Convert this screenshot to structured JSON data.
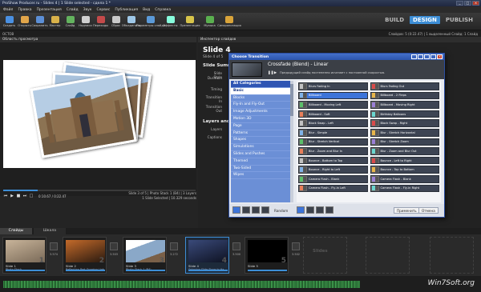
{
  "window": {
    "title": "ProShow Producer.ru - Slides 4 | 1 Slide selected - сдела 1 *",
    "buttons": [
      "_",
      "□",
      "×"
    ]
  },
  "menu": [
    "Файл",
    "Правка",
    "Презентация",
    "Слайд",
    "Звук",
    "Сервис",
    "Публикация",
    "Вид",
    "Справка"
  ],
  "toolbar": {
    "tools": [
      {
        "label": "Создать",
        "color": "#4a90e2"
      },
      {
        "label": "Открыть",
        "color": "#e2a64a"
      },
      {
        "label": "Сохранить",
        "color": "#5c8fd6"
      },
      {
        "label": "Мастер",
        "color": "#d9b24a"
      },
      {
        "label": "Слайд",
        "color": "#63b35e"
      },
      {
        "label": "Надписи",
        "color": "#cfcfcf"
      },
      {
        "label": "Переходы",
        "color": "#c44a4a"
      },
      {
        "label": "Сброс",
        "color": "#c9c9c9"
      },
      {
        "label": "Объединить",
        "color": "#9fc8e8"
      },
      {
        "label": "Параметры слайда",
        "color": "#5b9ad8"
      },
      {
        "label": "Эффекты",
        "color": "#8fd"
      },
      {
        "label": "Презентация",
        "color": "#d7c44a"
      },
      {
        "label": "Музыка",
        "color": "#5ab04f"
      },
      {
        "label": "Синхронизация",
        "color": "#d9a43a"
      }
    ],
    "modes": [
      "BUILD",
      "DESIGN",
      "PUBLISH"
    ],
    "active_mode": "DESIGN"
  },
  "subbar": {
    "left": "ОСТОВ",
    "right": "Слайдов: 5 (0:22.47) | 1 выделенный Слайд: 1 Слайд"
  },
  "preview": {
    "header": "Область просмотра",
    "time": "0:10.67 / 0:22.47",
    "info_lines": [
      "Slide 3 of 5 | Photo Stack 1 (B4) | 3 Layers",
      "1 Slide Selected | 10.329 seconds"
    ]
  },
  "options": {
    "header": "Инспектор слайдов",
    "title": "Slide 4",
    "subtitle": "Slide 4 of 5",
    "sections": [
      "Slide Summary",
      "Layers and E"
    ],
    "rows": [
      "Slide Style",
      "Duration",
      "Timing",
      "Transition In",
      "Transition Out",
      "Layers",
      "Captions"
    ]
  },
  "dialog": {
    "title": "Choose Transition",
    "current": "Crossfade (Blend) - Linear",
    "description": "Предыдущий слайд постепенно исчезает с постоянной скоростью.",
    "categories": [
      "All Categories",
      "Basic",
      "Blocks",
      "Fly-In and Fly-Out",
      "Image Adjustments",
      "Motion 3D",
      "Page",
      "Patterns",
      "Shapes",
      "Simulations",
      "Slides and Pushes",
      "Themed",
      "Two-Sided",
      "Wipes"
    ],
    "active_category": "All Categories",
    "selected_category": "Basic",
    "transitions": [
      "Blurs Fading In",
      "Blurs Fading Out",
      "Billboard",
      "Billboard - 2 Fleps",
      "Billboard - Moving Left",
      "Billboard - Moving Right",
      "Billboard - Soft",
      "Birthday Balloons",
      "Block Swap - Left",
      "Block Swap - Right",
      "Blur - Simple",
      "Blur - Stretch Horizontal",
      "Blur - Stretch Vertical",
      "Blur - Stretch Zoom",
      "Blur - Zoom and Blur In",
      "Blur - Zoom and Blur Out",
      "Bounce - Bottom to Top",
      "Bounce - Left to Right",
      "Bounce - Right to Left",
      "Bounce - Top to Bottom",
      "Camera Flash - Blank",
      "Camera Flash - Blank",
      "Camera Flash - Fly-in Left",
      "Camera Flash - Fly-in Right"
    ],
    "selected_transition": "Billboard",
    "footer": {
      "random": "Random",
      "apply": "Применить",
      "cancel": "Отмена",
      "chips": 8
    }
  },
  "tabs": [
    "Слайды",
    "Шкала"
  ],
  "slides": [
    {
      "name": "Slide 1",
      "desc": "Photo Stack",
      "num": "1",
      "trans": "3.574"
    },
    {
      "name": "Slide 2",
      "desc": "Reflection Part Growing Light",
      "num": "2",
      "trans": "3.503"
    },
    {
      "name": "Slide 3",
      "desc": "Photo Stack 1 (B4)",
      "num": "3",
      "trans": "3.272"
    },
    {
      "name": "Slide 4",
      "desc": "Spinning Slide Show In Ha...",
      "num": "4",
      "trans": "3.500"
    },
    {
      "name": "Slide 5",
      "desc": "",
      "num": "5",
      "trans": "3.502"
    }
  ],
  "slides_hint": "Slides",
  "watermark": "Win7Soft.org"
}
